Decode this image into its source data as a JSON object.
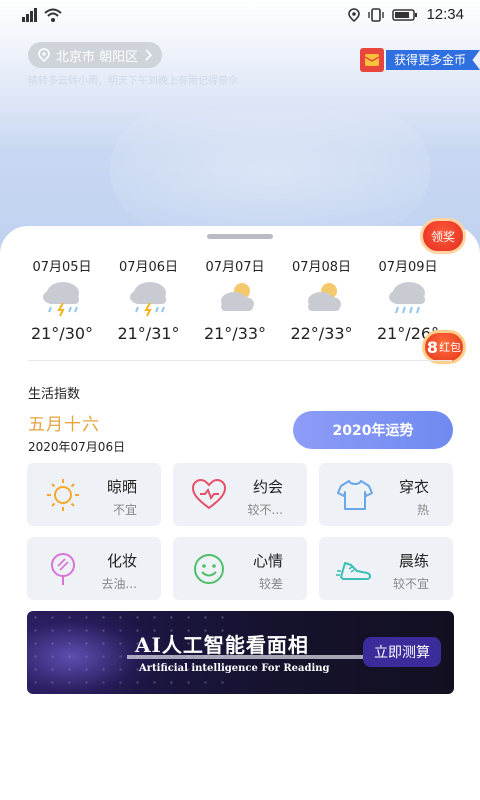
{
  "status_bar": {
    "time": "12:34",
    "signal_icon": "signal-icon",
    "wifi_icon": "wifi-icon",
    "location_icon": "location-icon",
    "vibrate_icon": "vibrate-icon",
    "battery_icon": "battery-icon"
  },
  "header": {
    "location": "北京市 朝阳区",
    "subtitle": "晴转多云转小雨，明天下午到晚上有雨记得带伞",
    "coin_button": "获得更多金币"
  },
  "floating": {
    "award_button": "领奖",
    "redpacket_count": "8",
    "redpacket_label": "红包"
  },
  "forecast": [
    {
      "date": "07月05日",
      "icon": "thunder-rain-icon",
      "temp": "21°/30°"
    },
    {
      "date": "07月06日",
      "icon": "thunder-rain-icon",
      "temp": "21°/31°"
    },
    {
      "date": "07月07日",
      "icon": "cloudy-sun-icon",
      "temp": "21°/33°"
    },
    {
      "date": "07月08日",
      "icon": "cloudy-sun-icon",
      "temp": "22°/33°"
    },
    {
      "date": "07月09日",
      "icon": "rain-icon",
      "temp": "21°/26°"
    }
  ],
  "life": {
    "title": "生活指数",
    "lunar_date": "五月十六",
    "solar_date": "2020年07月06日",
    "fortune_button": "2020年运势",
    "items": [
      {
        "name": "晾晒",
        "value": "不宜",
        "icon": "sun-icon"
      },
      {
        "name": "约会",
        "value": "较不...",
        "icon": "heart-icon"
      },
      {
        "name": "穿衣",
        "value": "热",
        "icon": "shirt-icon"
      },
      {
        "name": "化妆",
        "value": "去油...",
        "icon": "makeup-icon"
      },
      {
        "name": "心情",
        "value": "较差",
        "icon": "smile-icon"
      },
      {
        "name": "晨练",
        "value": "较不宜",
        "icon": "sneaker-icon"
      }
    ]
  },
  "banner": {
    "title": "AI人工智能看面相",
    "subtitle": "Artificial intelligence For Reading",
    "cta": "立即测算"
  },
  "colors": {
    "accent_blue": "#2f6fe0",
    "lunar_orange": "#e6a341",
    "fortune_purple": "#7f93f3",
    "card_bg": "#eef1f5"
  }
}
